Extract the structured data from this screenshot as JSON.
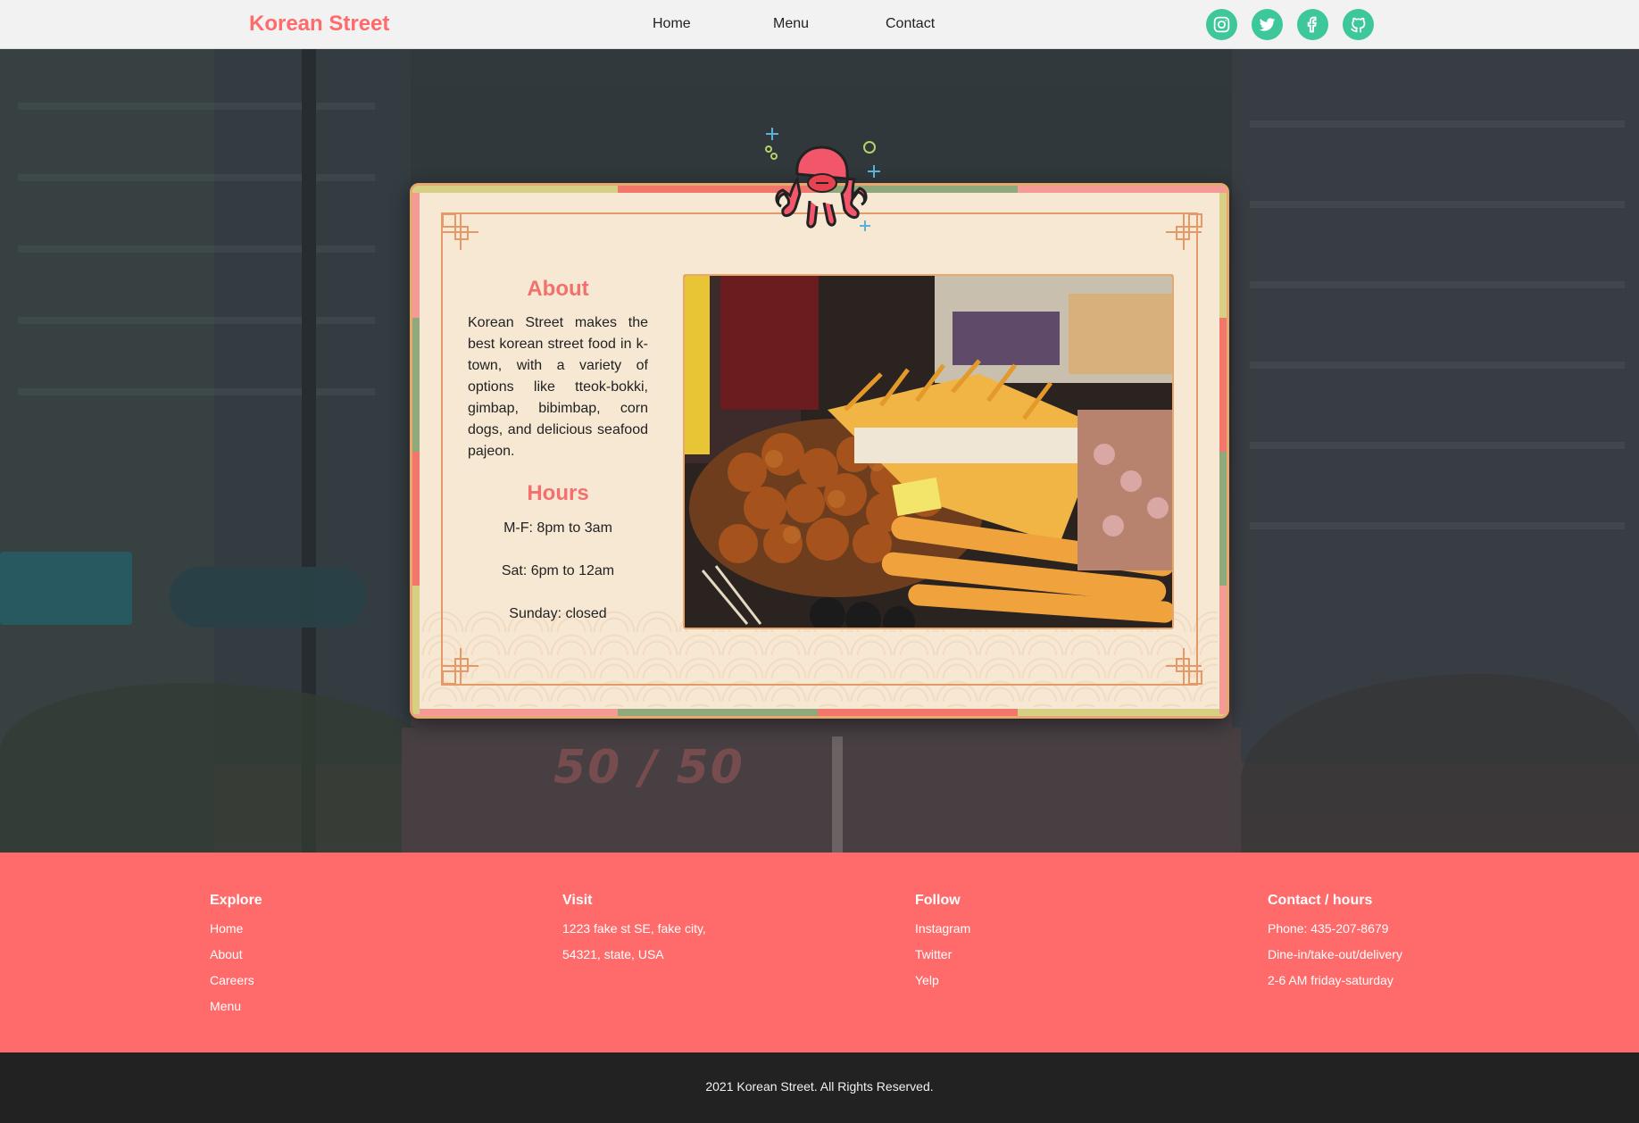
{
  "nav": {
    "brand": "Korean Street",
    "links": [
      "Home",
      "Menu",
      "Contact"
    ],
    "social_icons": [
      "instagram-icon",
      "twitter-icon",
      "facebook-icon",
      "github-icon"
    ],
    "accent_color": "#ff6b6b",
    "social_color": "#3ec79a"
  },
  "card": {
    "about_title": "About",
    "about_text": "Korean Street makes the best korean street food in k-town, with a variety of options like tteok-bokki, gimbap, bibimbap, corn dogs, and delicious seafood pajeon.",
    "hours_title": "Hours",
    "hours": [
      "M-F: 8pm to 3am",
      "Sat: 6pm to 12am",
      "Sunday: closed"
    ],
    "mascot_icon": "octopus-icon",
    "frame_color": "#e8a86d"
  },
  "footer": {
    "columns": [
      {
        "title": "Explore",
        "items": [
          "Home",
          "About",
          "Careers",
          "Menu"
        ]
      },
      {
        "title": "Visit",
        "items": [
          "1223 fake st SE, fake city,",
          "54321, state, USA"
        ]
      },
      {
        "title": "Follow",
        "items": [
          "Instagram",
          "Twitter",
          "Yelp"
        ]
      },
      {
        "title": "Contact / hours",
        "items": [
          "Phone: 435-207-8679",
          "Dine-in/take-out/delivery",
          "2-6 AM friday-saturday"
        ]
      }
    ],
    "copyright": "2021 Korean Street. All Rights Reserved.",
    "background_color": "#ff6b6b"
  }
}
